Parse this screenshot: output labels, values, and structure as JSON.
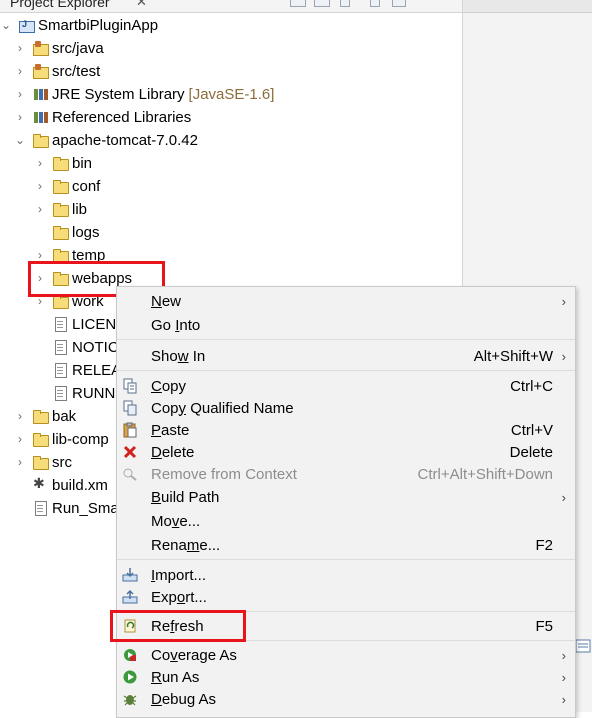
{
  "view": {
    "title": "Project Explorer",
    "close": "✕"
  },
  "tree": [
    {
      "label": "SmartbiPluginApp",
      "icon": "project-icon",
      "expanded": true
    },
    {
      "label": "src/java",
      "icon": "source-folder-icon"
    },
    {
      "label": "src/test",
      "icon": "source-folder-icon"
    },
    {
      "label": "JRE System Library",
      "decoration": "[JavaSE-1.6]",
      "icon": "library-icon"
    },
    {
      "label": "Referenced Libraries",
      "icon": "library-icon"
    },
    {
      "label": "apache-tomcat-7.0.42",
      "icon": "folder-icon",
      "expanded": true
    },
    {
      "label": "bin",
      "icon": "folder-icon"
    },
    {
      "label": "conf",
      "icon": "folder-icon"
    },
    {
      "label": "lib",
      "icon": "folder-icon"
    },
    {
      "label": "logs",
      "icon": "folder-icon"
    },
    {
      "label": "temp",
      "icon": "folder-icon"
    },
    {
      "label": "webapps",
      "icon": "folder-icon",
      "selected": true
    },
    {
      "label": "work",
      "icon": "folder-icon"
    },
    {
      "label": "LICEN",
      "icon": "file-icon"
    },
    {
      "label": "NOTIC",
      "icon": "file-icon"
    },
    {
      "label": "RELEA",
      "icon": "file-icon"
    },
    {
      "label": "RUNN",
      "icon": "file-icon"
    },
    {
      "label": "bak",
      "icon": "folder-icon"
    },
    {
      "label": "lib-comp",
      "icon": "folder-icon"
    },
    {
      "label": "src",
      "icon": "folder-icon"
    },
    {
      "label": "build.xm",
      "icon": "ant-file-icon"
    },
    {
      "label": "Run_Sma",
      "icon": "file-icon"
    }
  ],
  "menu": {
    "items": [
      {
        "label": "New",
        "mnemonic": "N",
        "shortcut": "",
        "submenu": true,
        "icon": ""
      },
      {
        "label": "Go Into",
        "mnemonic": "I",
        "shortcut": "",
        "submenu": false,
        "icon": ""
      },
      {
        "label": "Show In",
        "mnemonic": "w",
        "shortcut": "Alt+Shift+W",
        "submenu": true,
        "icon": ""
      },
      {
        "label": "Copy",
        "mnemonic": "C",
        "shortcut": "Ctrl+C",
        "submenu": false,
        "icon": "copy-icon"
      },
      {
        "label": "Copy Qualified Name",
        "mnemonic": "y",
        "shortcut": "",
        "submenu": false,
        "icon": "copy-qualified-name-icon"
      },
      {
        "label": "Paste",
        "mnemonic": "P",
        "shortcut": "Ctrl+V",
        "submenu": false,
        "icon": "paste-icon"
      },
      {
        "label": "Delete",
        "mnemonic": "D",
        "shortcut": "Delete",
        "submenu": false,
        "icon": "delete-icon"
      },
      {
        "label": "Remove from Context",
        "mnemonic": "",
        "shortcut": "Ctrl+Alt+Shift+Down",
        "submenu": false,
        "icon": "remove-context-icon",
        "disabled": true
      },
      {
        "label": "Build Path",
        "mnemonic": "B",
        "shortcut": "",
        "submenu": true,
        "icon": ""
      },
      {
        "label": "Move...",
        "mnemonic": "v",
        "shortcut": "",
        "submenu": false,
        "icon": ""
      },
      {
        "label": "Rename...",
        "mnemonic": "m",
        "shortcut": "F2",
        "submenu": false,
        "icon": ""
      },
      {
        "label": "Import...",
        "mnemonic": "I",
        "shortcut": "",
        "submenu": false,
        "icon": "import-icon"
      },
      {
        "label": "Export...",
        "mnemonic": "o",
        "shortcut": "",
        "submenu": false,
        "icon": "export-icon"
      },
      {
        "label": "Refresh",
        "mnemonic": "f",
        "shortcut": "F5",
        "submenu": false,
        "icon": "refresh-icon"
      },
      {
        "label": "Coverage As",
        "mnemonic": "v",
        "shortcut": "",
        "submenu": true,
        "icon": "coverage-icon"
      },
      {
        "label": "Run As",
        "mnemonic": "R",
        "shortcut": "",
        "submenu": true,
        "icon": "run-icon"
      },
      {
        "label": "Debug As",
        "mnemonic": "D",
        "shortcut": "",
        "submenu": true,
        "icon": "debug-icon"
      }
    ]
  },
  "colors": {
    "highlight": "#e8131b",
    "menu_bg": "#f2f2f2",
    "disabled_text": "#8d8d8d",
    "decoration": "#8a6d3b"
  }
}
